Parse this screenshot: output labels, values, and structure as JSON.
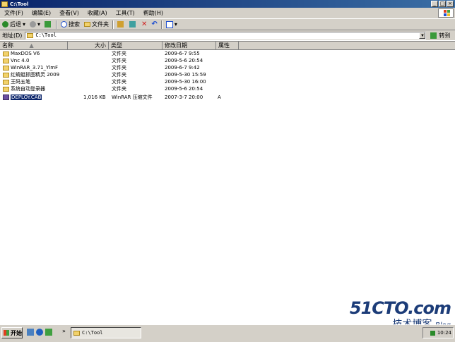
{
  "window": {
    "title": "C:\\Tool"
  },
  "menu": [
    "文件(F)",
    "编辑(E)",
    "查看(V)",
    "收藏(A)",
    "工具(T)",
    "帮助(H)"
  ],
  "toolbar": {
    "back": "后退",
    "search": "搜索",
    "folders": "文件夹"
  },
  "address": {
    "label": "地址(D)",
    "path": "C:\\Tool",
    "go": "转到"
  },
  "columns": {
    "name": "名称",
    "size": "大小",
    "type": "类型",
    "modified": "修改日期",
    "attr": "属性"
  },
  "files": [
    {
      "name": "MaxDOS V6",
      "size": "",
      "type": "文件夹",
      "modified": "2009-6-7 9:55",
      "attr": "",
      "kind": "folder"
    },
    {
      "name": "Vnc 4.0",
      "size": "",
      "type": "文件夹",
      "modified": "2009-5-6 20:54",
      "attr": "",
      "kind": "folder"
    },
    {
      "name": "WinRAR_3.71_YlmF",
      "size": "",
      "type": "文件夹",
      "modified": "2009-6-7 9:42",
      "attr": "",
      "kind": "folder"
    },
    {
      "name": "红蜻蜓抓图精灵 2009",
      "size": "",
      "type": "文件夹",
      "modified": "2009-5-30 15:59",
      "attr": "",
      "kind": "folder"
    },
    {
      "name": "王码五笔",
      "size": "",
      "type": "文件夹",
      "modified": "2009-5-30 16:00",
      "attr": "",
      "kind": "folder"
    },
    {
      "name": "系统自动登录器",
      "size": "",
      "type": "文件夹",
      "modified": "2009-5-6 20:54",
      "attr": "",
      "kind": "folder"
    },
    {
      "name": "DEPLOY.CAB",
      "size": "1,016 KB",
      "type": "WinRAR 压缩文件",
      "modified": "2007-3-7 20:00",
      "attr": "A",
      "kind": "archive"
    }
  ],
  "taskbar": {
    "start": "开始",
    "task": "C:\\Tool",
    "clock": "10:24"
  },
  "watermark": {
    "site": "51CTO.com",
    "blog_cn": "技术博客",
    "blog": "Blog"
  }
}
